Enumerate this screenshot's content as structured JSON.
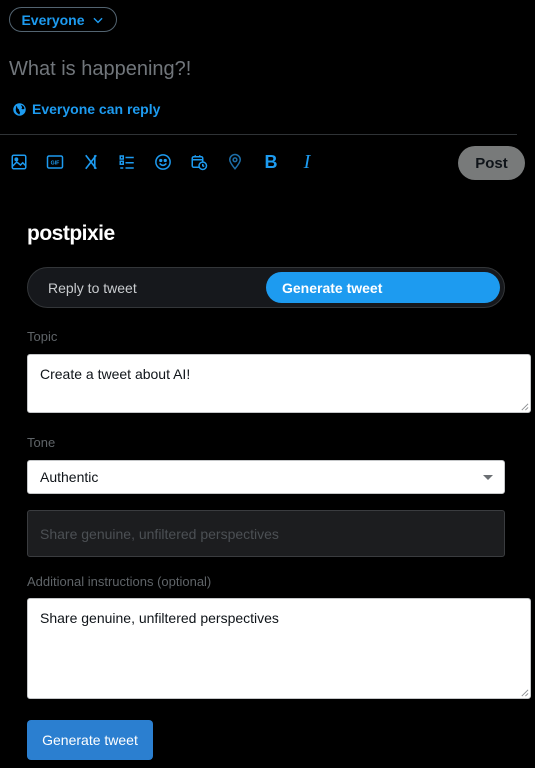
{
  "composer": {
    "audience_label": "Everyone",
    "placeholder": "What is happening?!",
    "reply_setting": "Everyone can reply",
    "post_label": "Post",
    "toolbar_icons": [
      "image-icon",
      "gif-icon",
      "grok-icon",
      "poll-icon",
      "emoji-icon",
      "schedule-icon",
      "location-icon",
      "bold-icon",
      "italic-icon"
    ],
    "bold_glyph": "B",
    "italic_glyph": "I",
    "gif_glyph": "GIF"
  },
  "extension": {
    "brand": "postpixie",
    "tabs": [
      {
        "label": "Reply to tweet",
        "active": false
      },
      {
        "label": "Generate tweet",
        "active": true
      }
    ],
    "topic": {
      "label": "Topic",
      "value": "Create a tweet about AI!"
    },
    "tone": {
      "label": "Tone",
      "selected": "Authentic",
      "description": "Share genuine, unfiltered perspectives"
    },
    "additional": {
      "label": "Additional instructions (optional)",
      "value": "Share genuine, unfiltered perspectives"
    },
    "generate_label": "Generate tweet"
  },
  "colors": {
    "background": "#000000",
    "accent": "#1d9bf0",
    "post_button": "#787a7a",
    "generate_button": "#2b7fd0"
  }
}
